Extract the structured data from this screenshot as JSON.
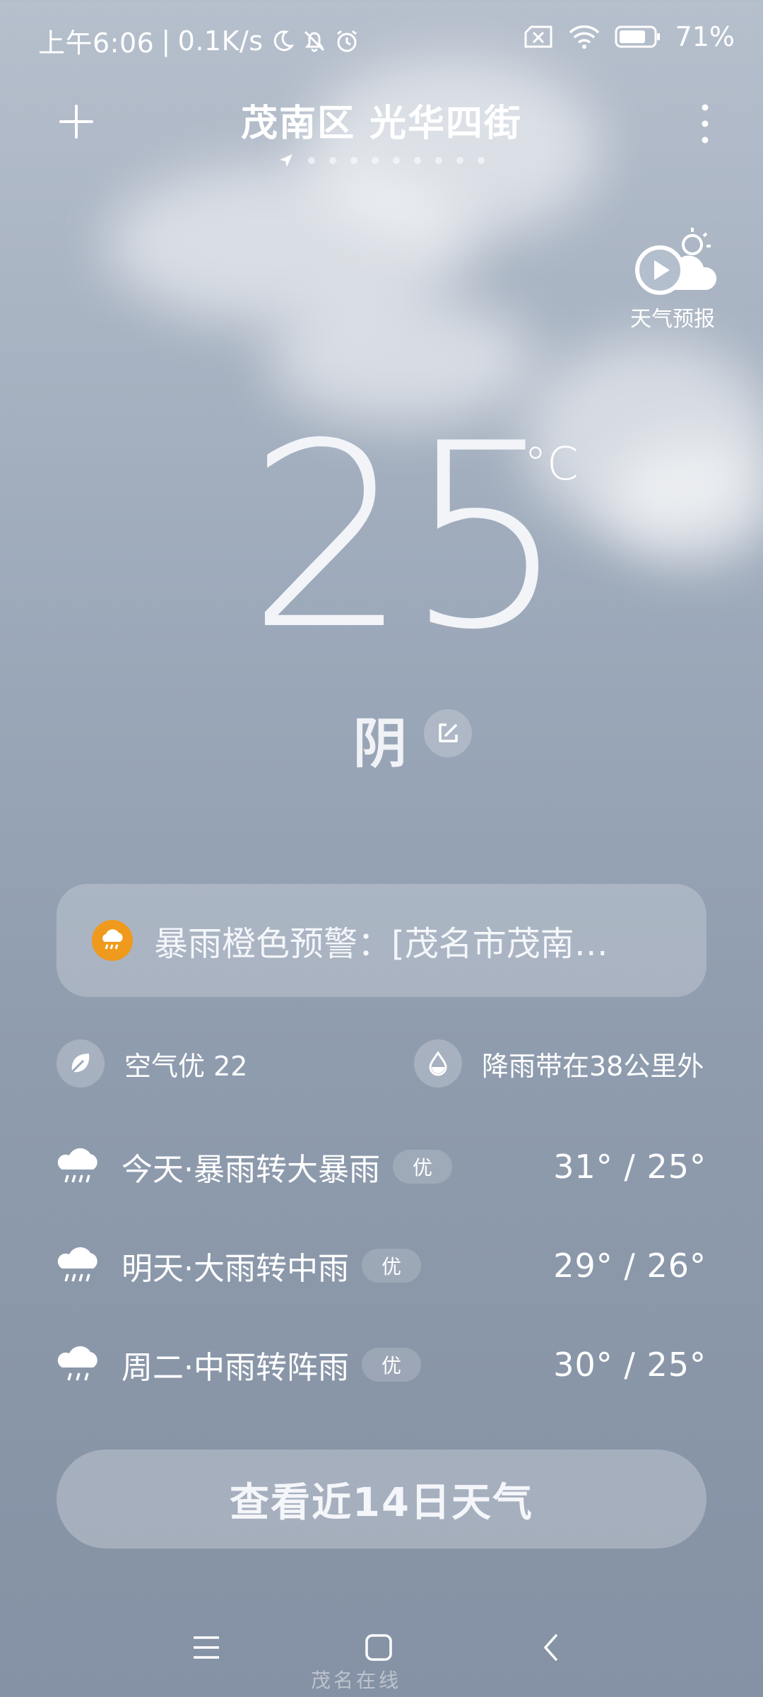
{
  "status_bar": {
    "time": "上午6:06",
    "net_speed": "0.1K/s",
    "battery": "71%"
  },
  "header": {
    "location": "茂南区 光华四街",
    "page_count": 10
  },
  "forecast_video": {
    "label": "天气预报"
  },
  "current": {
    "temperature": "25",
    "unit": "°C",
    "condition": "阴"
  },
  "alert": {
    "text": "暴雨橙色预警：[茂名市茂南…",
    "color": "#ef9a1c"
  },
  "info": {
    "air_quality": "空气优 22",
    "rain_band": "降雨带在38公里外"
  },
  "daily": [
    {
      "label": "今天·暴雨转大暴雨",
      "aqi": "优",
      "temps": "31° / 25°"
    },
    {
      "label": "明天·大雨转中雨",
      "aqi": "优",
      "temps": "29° / 26°"
    },
    {
      "label": "周二·中雨转阵雨",
      "aqi": "优",
      "temps": "30° / 25°"
    }
  ],
  "forecast_button": "查看近14日天气",
  "watermark": "茂名在线"
}
